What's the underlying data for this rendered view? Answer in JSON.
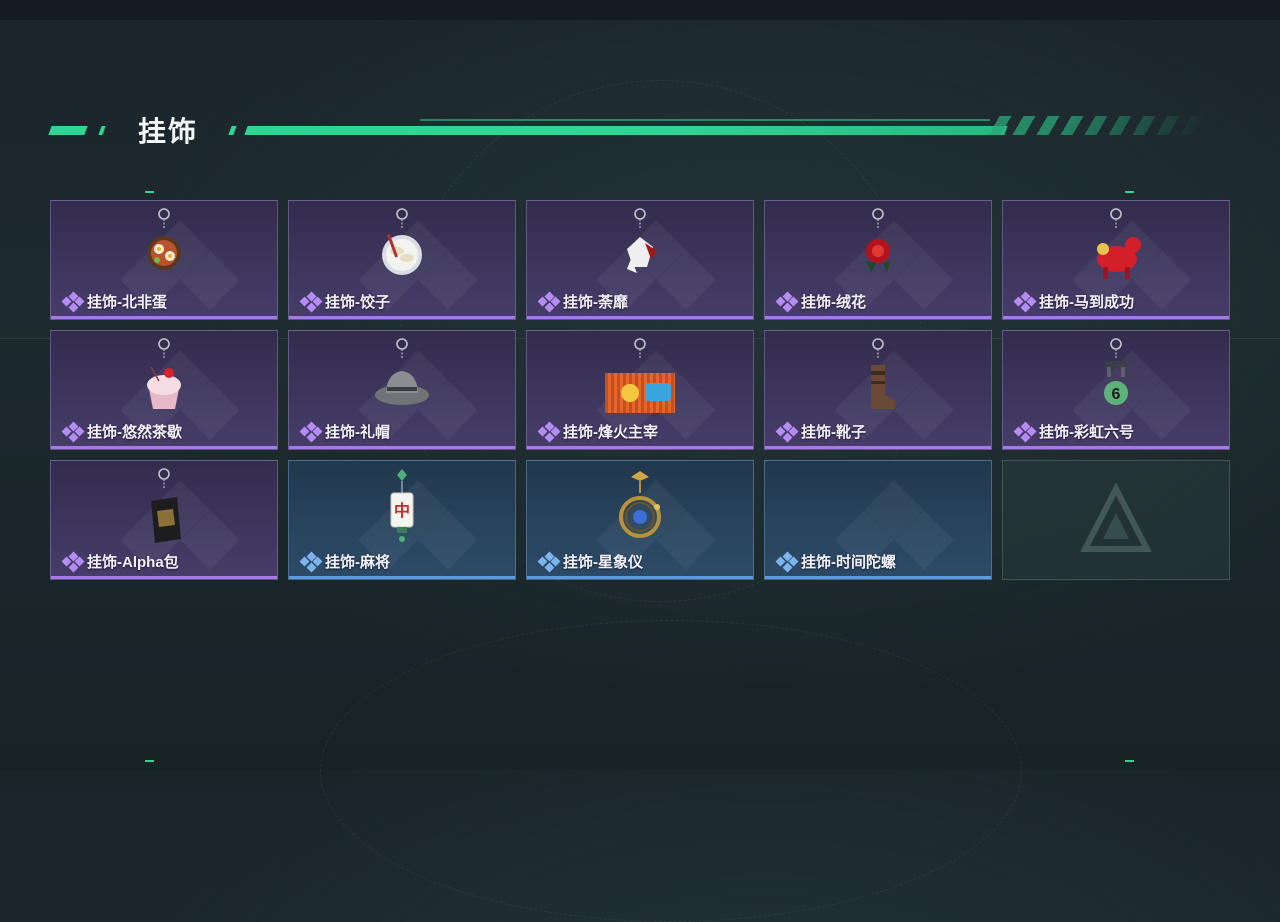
{
  "section": {
    "title": "挂饰"
  },
  "colors": {
    "accent": "#2ed694",
    "purple_rarity": "#a779e8",
    "blue_rarity": "#5a9be0"
  },
  "items": [
    {
      "label": "挂饰-北非蛋",
      "rarity": "purple",
      "icon": "shakshuka-pan-charm-icon"
    },
    {
      "label": "挂饰-饺子",
      "rarity": "purple",
      "icon": "dumpling-plate-charm-icon"
    },
    {
      "label": "挂饰-荼靡",
      "rarity": "purple",
      "icon": "flower-charm-icon"
    },
    {
      "label": "挂饰-绒花",
      "rarity": "purple",
      "icon": "velvet-flower-charm-icon"
    },
    {
      "label": "挂饰-马到成功",
      "rarity": "purple",
      "icon": "red-horse-charm-icon"
    },
    {
      "label": "挂饰-悠然茶歇",
      "rarity": "purple",
      "icon": "cupcake-charm-icon"
    },
    {
      "label": "挂饰-礼帽",
      "rarity": "purple",
      "icon": "fedora-hat-charm-icon"
    },
    {
      "label": "挂饰-烽火主宰",
      "rarity": "purple",
      "icon": "graffiti-container-charm-icon"
    },
    {
      "label": "挂饰-靴子",
      "rarity": "purple",
      "icon": "boot-charm-icon"
    },
    {
      "label": "挂饰-彩虹六号",
      "rarity": "purple",
      "icon": "rainbow-six-charm-icon"
    },
    {
      "label": "挂饰-Alpha包",
      "rarity": "purple",
      "icon": "alpha-bag-charm-icon"
    },
    {
      "label": "挂饰-麻将",
      "rarity": "blue",
      "icon": "mahjong-tile-charm-icon"
    },
    {
      "label": "挂饰-星象仪",
      "rarity": "blue",
      "icon": "astrolabe-charm-icon"
    },
    {
      "label": "挂饰-时间陀螺",
      "rarity": "blue",
      "icon": ""
    },
    {
      "label": "",
      "rarity": "empty",
      "icon": "delta-logo-icon"
    }
  ]
}
